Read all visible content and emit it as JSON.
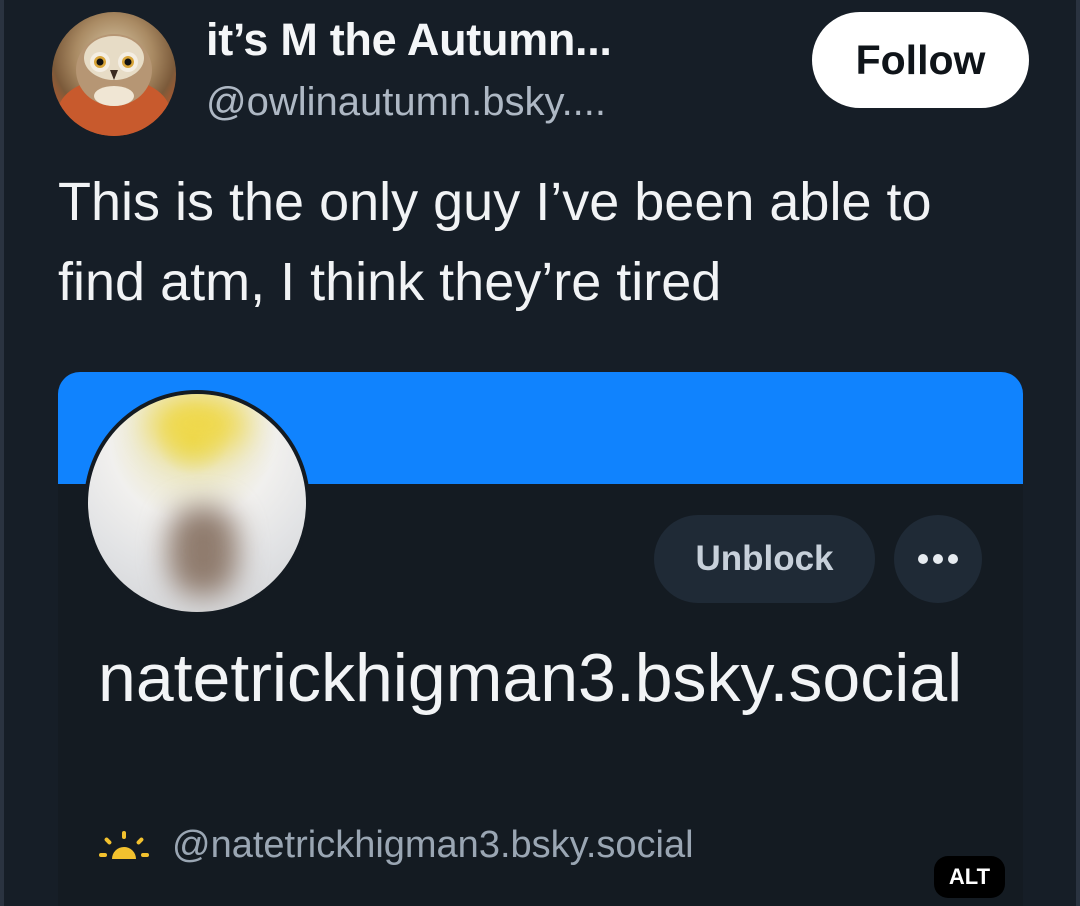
{
  "author": {
    "display_name": "it’s M the Autumn...",
    "handle": "@owlinautumn.bsky....",
    "avatar_icon": "owl-avatar"
  },
  "follow_label": "Follow",
  "post": {
    "text": "This is the only guy I’ve been able to find atm, I think they’re tired"
  },
  "embed": {
    "banner_color": "#1083fe",
    "unblock_label": "Unblock",
    "more_icon": "ellipsis-icon",
    "profile_name": "natetrickhigman3.bsky.social",
    "handle_icon": "sun-icon",
    "profile_handle": "@natetrickhigman3.bsky.social"
  },
  "alt_label": "ALT"
}
